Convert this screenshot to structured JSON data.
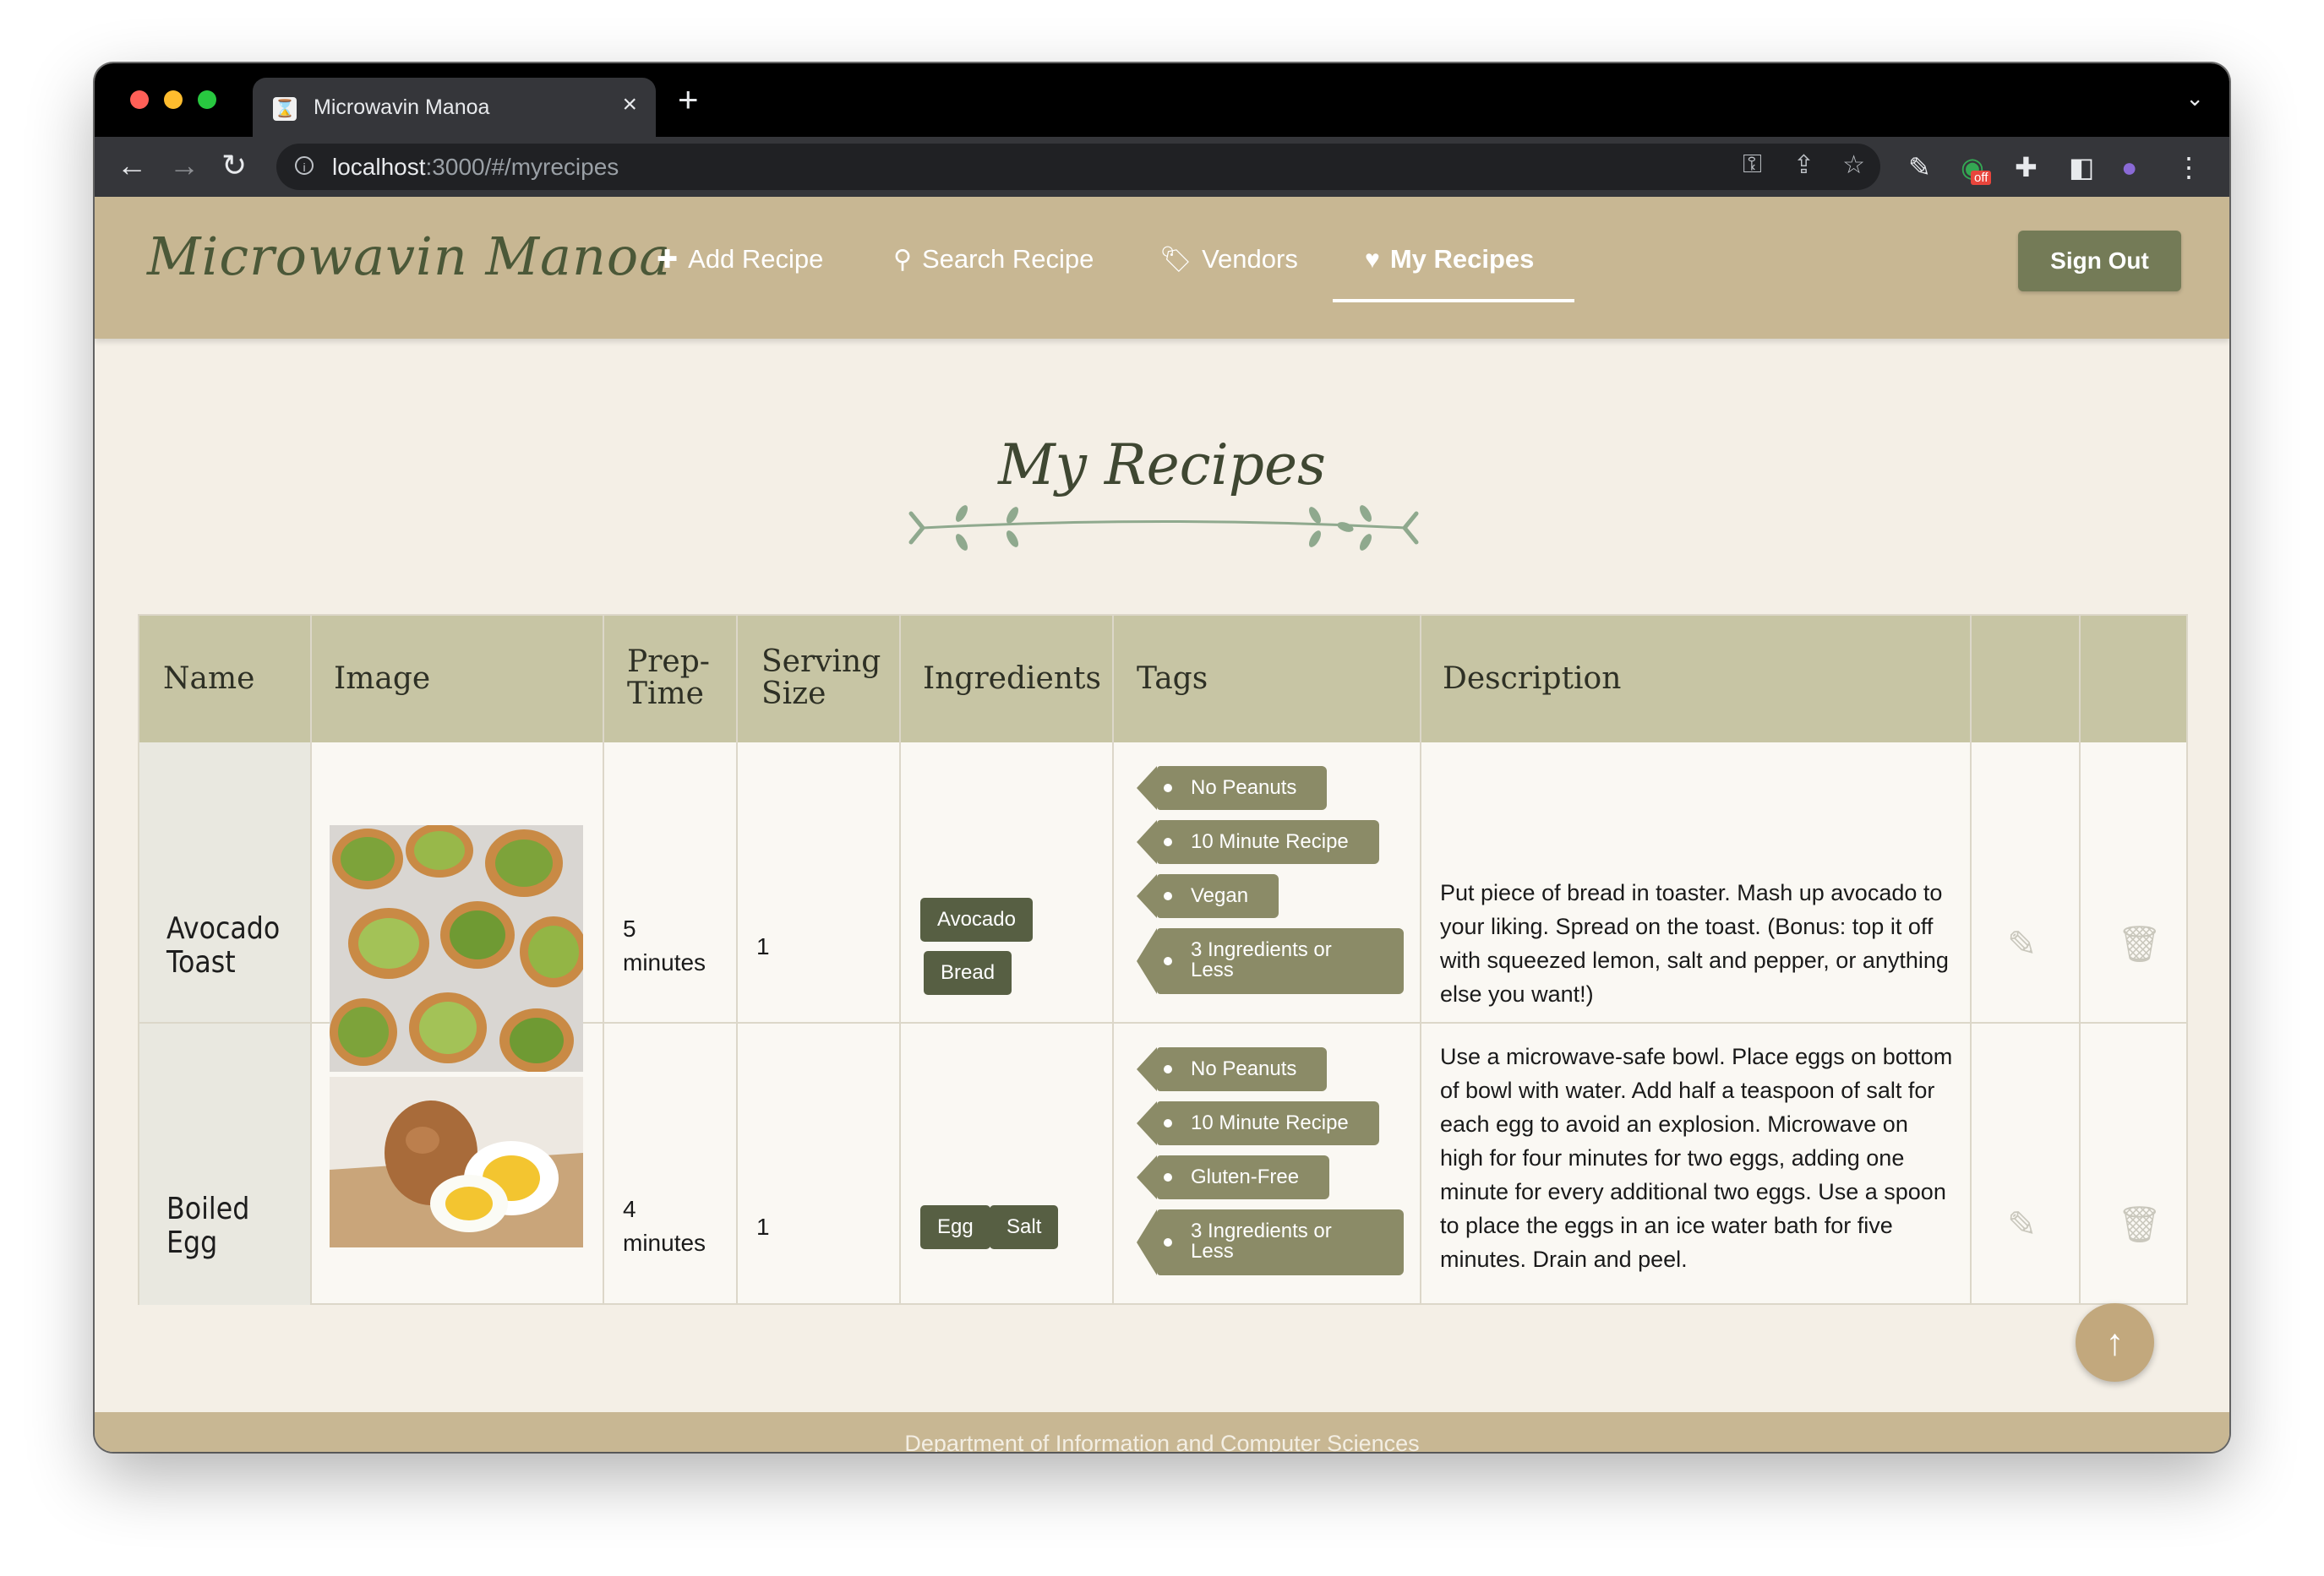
{
  "browser": {
    "tab_title": "Microwavin Manoa",
    "url_host": "localhost",
    "url_path": ":3000/#/myrecipes",
    "new_tab_symbol": "+",
    "close_symbol": "×",
    "extension_badge": "off"
  },
  "navbar": {
    "brand": "Microwavin Manoa",
    "links": [
      {
        "label": "Add Recipe",
        "icon": "plus-icon"
      },
      {
        "label": "Search Recipe",
        "icon": "search-icon"
      },
      {
        "label": "Vendors",
        "icon": "tags-icon"
      },
      {
        "label": "My Recipes",
        "icon": "heart-icon",
        "active": true
      }
    ],
    "sign_out": "Sign Out"
  },
  "page": {
    "title": "My Recipes"
  },
  "table": {
    "headers": [
      "Name",
      "Image",
      "Prep-\nTime",
      "Serving\nSize",
      "Ingredients",
      "Tags",
      "Description",
      "",
      ""
    ],
    "rows": [
      {
        "name_line1": "Avocado",
        "name_line2": "Toast",
        "image": "avocado-toast-photo",
        "prep_value": "5",
        "prep_unit": "minutes",
        "serving": "1",
        "ingredients": [
          "Avocado",
          "Bread"
        ],
        "tags": [
          "No Peanuts",
          "10 Minute Recipe",
          "Vegan",
          "3 Ingredients or Less"
        ],
        "description": "Put piece of bread in toaster. Mash up avocado to your liking. Spread on the toast. (Bonus: top it off with squeezed lemon, salt and pepper, or anything else you want!)"
      },
      {
        "name_line1": "Boiled",
        "name_line2": "Egg",
        "image": "boiled-egg-photo",
        "prep_value": "4",
        "prep_unit": "minutes",
        "serving": "1",
        "ingredients": [
          "Egg",
          "Salt"
        ],
        "tags": [
          "No Peanuts",
          "10 Minute Recipe",
          "Gluten-Free",
          "3 Ingredients or Less"
        ],
        "description": "Use a microwave-safe bowl. Place eggs on bottom of bowl with water. Add half a teaspoon of salt for each egg to avoid an explosion. Microwave on high for four minutes for two eggs, adding one minute for every additional two eggs. Use a spoon to place the eggs in an ice water bath for five minutes. Drain and peel."
      }
    ]
  },
  "footer": {
    "text": "Department of Information and Computer Sciences"
  },
  "colors": {
    "navbar": "#c8b793",
    "brand": "#4b5838",
    "sign_out": "#747b57",
    "table_header": "#c7c5a4",
    "ingredient_label": "#575f43",
    "tag_label": "#8b8b67",
    "scroll_top": "#c2a87d"
  }
}
